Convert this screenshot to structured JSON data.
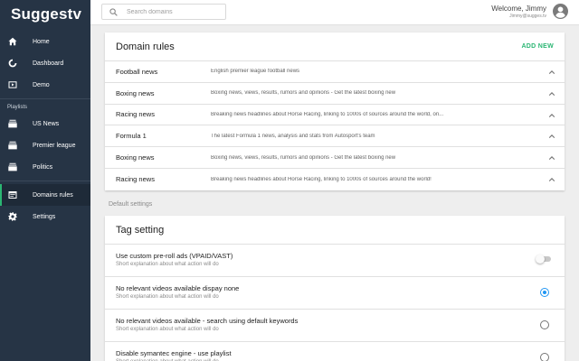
{
  "app": {
    "brand": "Suggestv"
  },
  "sidebar": {
    "items": [
      {
        "label": "Home",
        "icon": "home-icon"
      },
      {
        "label": "Dashboard",
        "icon": "circle-icon"
      },
      {
        "label": "Demo",
        "icon": "play-screen-icon"
      }
    ],
    "section_label": "Playlists",
    "playlists": [
      {
        "label": "US News",
        "icon": "stack-icon"
      },
      {
        "label": "Premier league",
        "icon": "stack-icon"
      },
      {
        "label": "Politics",
        "icon": "stack-icon"
      }
    ],
    "bottom_items": [
      {
        "label": "Domains rules",
        "icon": "rules-icon",
        "active": true
      },
      {
        "label": "Settings",
        "icon": "gear-icon"
      }
    ],
    "accent_color": "#2bb673",
    "background_color": "#263445"
  },
  "topbar": {
    "search_placeholder": "Search domains",
    "welcome": "Welcome, Jimmy",
    "email": "Jimmy@sugges.tv"
  },
  "domain_rules": {
    "title": "Domain rules",
    "add_label": "ADD NEW",
    "rows": [
      {
        "name": "Football news",
        "description": "English premier league football news"
      },
      {
        "name": "Boxing news",
        "description": "Boxing news, views, results, rumors and opinions - Get the latest boxing new"
      },
      {
        "name": "Racing news",
        "description": "Breaking news headlines about Horse Racing, linking to 1000s of sources around the world, on..."
      },
      {
        "name": "Formula 1",
        "description": "The latest Formula 1 news, analysis and stats from Autosport's team"
      },
      {
        "name": "Boxing news",
        "description": "Boxing news, views, results, rumors and opinions - Get the latest boxing new"
      },
      {
        "name": "Racing news",
        "description": "Breaking news headlines about Horse Racing, linking to 1000s of sources around the world!"
      }
    ]
  },
  "default_settings": {
    "label": "Default settings",
    "card_title": "Tag setting",
    "rows": [
      {
        "title": "Use custom pre-roll ads (VPAID/VAST)",
        "subtitle": "Short explanation about what action will do",
        "control": "toggle",
        "value": false
      },
      {
        "title": "No relevant videos available dispay none",
        "subtitle": "Short explanation about what action will do",
        "control": "radio",
        "value": true
      },
      {
        "title": "No relevant videos available - search using default keywords",
        "subtitle": "Short explanation about what action will do",
        "control": "radio",
        "value": false
      },
      {
        "title": "Disable symantec engine - use playlist",
        "subtitle": "Short explanation about what action will do",
        "control": "radio",
        "value": false
      }
    ],
    "radio_color": "#2196f3"
  }
}
